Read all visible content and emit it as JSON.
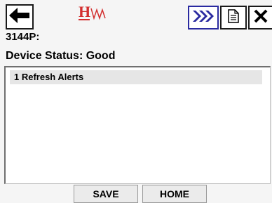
{
  "toolbar": {
    "back_icon": "left-arrow-icon",
    "logo_icon": "hw-logo-icon",
    "forward_icon": "fast-forward-icon",
    "document_icon": "document-icon",
    "close_icon": "close-icon",
    "forward_color": "#2a2aa0",
    "logo_color": "#d32f2f"
  },
  "device": {
    "id": "3144P:",
    "status": "Device Status: Good"
  },
  "list": {
    "items": [
      {
        "label": "1 Refresh Alerts"
      }
    ]
  },
  "bottom_bar": {
    "save_label": "SAVE",
    "home_label": "HOME"
  }
}
